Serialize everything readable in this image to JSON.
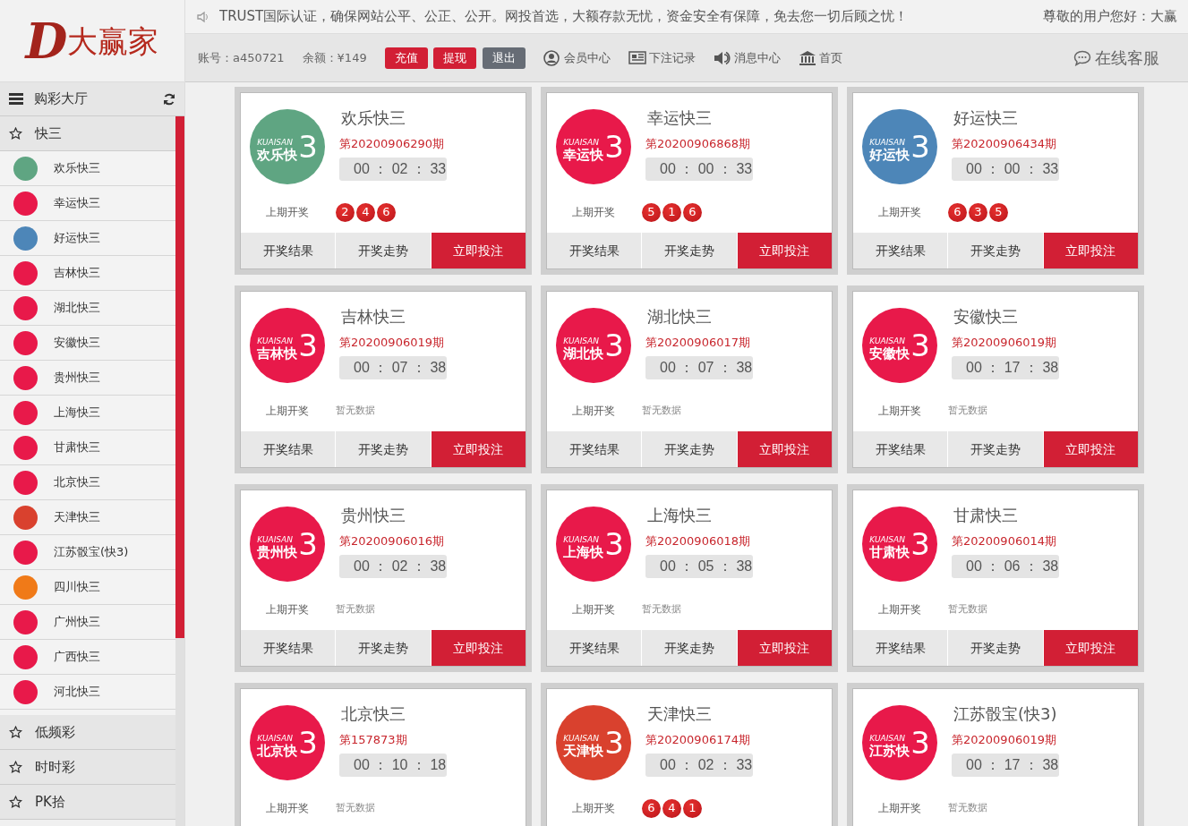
{
  "logo": {
    "letter": "D",
    "name": "大赢家"
  },
  "marquee": "TRUST国际认证，确保网站公平、公正、公开。网投首选，大额存款无忧，资金安全有保障，免去您一切后顾之忧！",
  "greeting": "尊敬的用户您好：大赢",
  "account": {
    "label": "账号：",
    "value": "a450721"
  },
  "balance": {
    "label": "余额：",
    "value": "¥149"
  },
  "account_buttons": [
    {
      "label": "充值",
      "kind": "primary"
    },
    {
      "label": "提现",
      "kind": "primary"
    },
    {
      "label": "退出",
      "kind": "secondary"
    }
  ],
  "nav_links": [
    {
      "label": "会员中心"
    },
    {
      "label": "下注记录"
    },
    {
      "label": "消息中心"
    },
    {
      "label": "首页"
    }
  ],
  "support": "在线客服",
  "sidebar": {
    "title": "购彩大厅",
    "groups": [
      {
        "label": "快三",
        "expanded": true,
        "children": [
          {
            "label": "欢乐快三",
            "color": "#5fa582"
          },
          {
            "label": "幸运快三",
            "color": "#e8194a"
          },
          {
            "label": "好运快三",
            "color": "#4d86b8"
          },
          {
            "label": "吉林快三",
            "color": "#e8194a"
          },
          {
            "label": "湖北快三",
            "color": "#e8194a"
          },
          {
            "label": "安徽快三",
            "color": "#e8194a"
          },
          {
            "label": "贵州快三",
            "color": "#e8194a"
          },
          {
            "label": "上海快三",
            "color": "#e8194a"
          },
          {
            "label": "甘肃快三",
            "color": "#e8194a"
          },
          {
            "label": "北京快三",
            "color": "#e8194a"
          },
          {
            "label": "天津快三",
            "color": "#d9412e"
          },
          {
            "label": "江苏骰宝(快3)",
            "color": "#e8194a"
          },
          {
            "label": "四川快三",
            "color": "#f07a18"
          },
          {
            "label": "广州快三",
            "color": "#e8194a"
          },
          {
            "label": "广西快三",
            "color": "#e8194a"
          },
          {
            "label": "河北快三",
            "color": "#e8194a"
          }
        ]
      },
      {
        "label": "低频彩",
        "expanded": false
      },
      {
        "label": "时时彩",
        "expanded": false
      },
      {
        "label": "PK拾",
        "expanded": false
      }
    ]
  },
  "games": [
    {
      "title": "欢乐快三",
      "period": "第20200906290期",
      "timer": "00 ： 02 ： 33",
      "logo": {
        "color": "#5fa582",
        "brand": "KUAISAN",
        "name": "欢乐快",
        "digit": "3"
      },
      "last_label": "上期开奖",
      "balls": [
        "2",
        "4",
        "6"
      ],
      "actions": [
        "开奖结果",
        "开奖走势",
        "立即投注"
      ]
    },
    {
      "title": "幸运快三",
      "period": "第20200906868期",
      "timer": "00 ： 00 ： 33",
      "logo": {
        "color": "#e8194a",
        "brand": "KUAISAN",
        "name": "幸运快",
        "digit": "3"
      },
      "last_label": "上期开奖",
      "balls": [
        "5",
        "1",
        "6"
      ],
      "actions": [
        "开奖结果",
        "开奖走势",
        "立即投注"
      ]
    },
    {
      "title": "好运快三",
      "period": "第20200906434期",
      "timer": "00 ： 00 ： 33",
      "logo": {
        "color": "#4d86b8",
        "brand": "KUAISAN",
        "name": "好运快",
        "digit": "3"
      },
      "last_label": "上期开奖",
      "balls": [
        "6",
        "3",
        "5"
      ],
      "actions": [
        "开奖结果",
        "开奖走势",
        "立即投注"
      ]
    },
    {
      "title": "吉林快三",
      "period": "第20200906019期",
      "timer": "00 ： 07 ： 38",
      "logo": {
        "color": "#e8194a",
        "brand": "KUAISAN",
        "name": "吉林快",
        "digit": "3"
      },
      "last_label": "上期开奖",
      "no_data": "暂无数据",
      "actions": [
        "开奖结果",
        "开奖走势",
        "立即投注"
      ]
    },
    {
      "title": "湖北快三",
      "period": "第20200906017期",
      "timer": "00 ： 07 ： 38",
      "logo": {
        "color": "#e8194a",
        "brand": "KUAISAN",
        "name": "湖北快",
        "digit": "3"
      },
      "last_label": "上期开奖",
      "no_data": "暂无数据",
      "actions": [
        "开奖结果",
        "开奖走势",
        "立即投注"
      ]
    },
    {
      "title": "安徽快三",
      "period": "第20200906019期",
      "timer": "00 ： 17 ： 38",
      "logo": {
        "color": "#e8194a",
        "brand": "KUAISAN",
        "name": "安徽快",
        "digit": "3"
      },
      "last_label": "上期开奖",
      "no_data": "暂无数据",
      "actions": [
        "开奖结果",
        "开奖走势",
        "立即投注"
      ]
    },
    {
      "title": "贵州快三",
      "period": "第20200906016期",
      "timer": "00 ： 02 ： 38",
      "logo": {
        "color": "#e8194a",
        "brand": "KUAISAN",
        "name": "贵州快",
        "digit": "3"
      },
      "last_label": "上期开奖",
      "no_data": "暂无数据",
      "actions": [
        "开奖结果",
        "开奖走势",
        "立即投注"
      ]
    },
    {
      "title": "上海快三",
      "period": "第20200906018期",
      "timer": "00 ： 05 ： 38",
      "logo": {
        "color": "#e8194a",
        "brand": "KUAISAN",
        "name": "上海快",
        "digit": "3"
      },
      "last_label": "上期开奖",
      "no_data": "暂无数据",
      "actions": [
        "开奖结果",
        "开奖走势",
        "立即投注"
      ]
    },
    {
      "title": "甘肃快三",
      "period": "第20200906014期",
      "timer": "00 ： 06 ： 38",
      "logo": {
        "color": "#e8194a",
        "brand": "KUAISAN",
        "name": "甘肃快",
        "digit": "3"
      },
      "last_label": "上期开奖",
      "no_data": "暂无数据",
      "actions": [
        "开奖结果",
        "开奖走势",
        "立即投注"
      ]
    },
    {
      "title": "北京快三",
      "period": "第157873期",
      "timer": "00 ： 10 ： 18",
      "logo": {
        "color": "#e8194a",
        "brand": "KUAISAN",
        "name": "北京快",
        "digit": "3"
      },
      "last_label": "上期开奖",
      "no_data": "暂无数据"
    },
    {
      "title": "天津快三",
      "period": "第20200906174期",
      "timer": "00 ： 02 ： 33",
      "logo": {
        "color": "#d9412e",
        "brand": "KUAISAN",
        "name": "天津快",
        "digit": "3"
      },
      "last_label": "上期开奖",
      "balls": [
        "6",
        "4",
        "1"
      ]
    },
    {
      "title": "江苏骰宝(快3)",
      "period": "第20200906019期",
      "timer": "00 ： 17 ： 38",
      "logo": {
        "color": "#e8194a",
        "brand": "KUAISAN",
        "name": "江苏快",
        "digit": "3"
      },
      "last_label": "上期开奖",
      "no_data": "暂无数据"
    }
  ]
}
